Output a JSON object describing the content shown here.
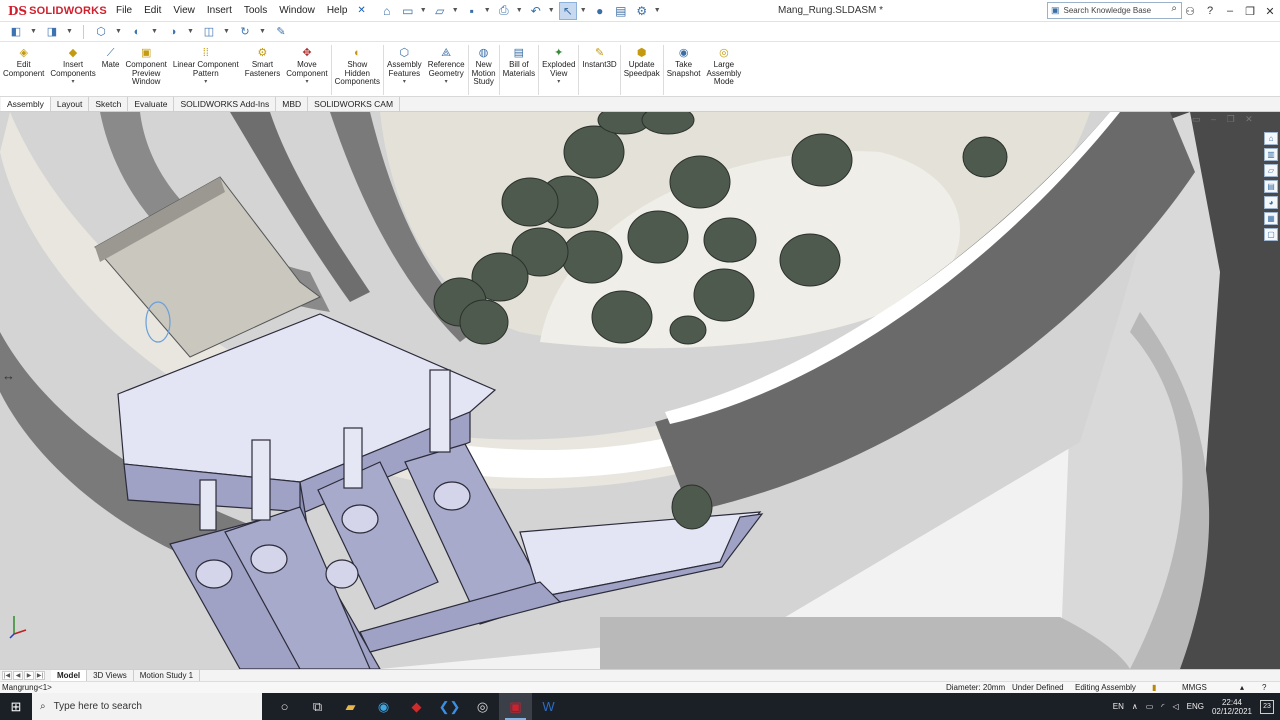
{
  "app": {
    "logo_mark": "DS",
    "logo_text": "SOLIDWORKS",
    "document_title": "Mang_Rung.SLDASM *"
  },
  "menu": [
    "File",
    "Edit",
    "View",
    "Insert",
    "Tools",
    "Window",
    "Help"
  ],
  "search": {
    "placeholder": "Search Knowledge Base"
  },
  "window_controls": {
    "help": "?",
    "minimize": "–",
    "restore": "❐",
    "close": "✕"
  },
  "ribbon": [
    {
      "label": "Edit\nComponent",
      "icon": "edit-component-icon",
      "glyph": "◈",
      "color": "ric-g"
    },
    {
      "label": "Insert\nComponents",
      "icon": "insert-components-icon",
      "glyph": "◆",
      "color": "ric-g",
      "dropdown": true
    },
    {
      "label": "Mate",
      "icon": "mate-icon",
      "glyph": "⟋",
      "color": "ric-b"
    },
    {
      "label": "Component\nPreview\nWindow",
      "icon": "preview-window-icon",
      "glyph": "▣",
      "color": "ric-g"
    },
    {
      "label": "Linear Component\nPattern",
      "icon": "linear-pattern-icon",
      "glyph": "⁞⁞",
      "color": "ric-g",
      "dropdown": true
    },
    {
      "label": "Smart\nFasteners",
      "icon": "smart-fasteners-icon",
      "glyph": "⚙",
      "color": "ric-g"
    },
    {
      "label": "Move\nComponent",
      "icon": "move-component-icon",
      "glyph": "✥",
      "color": "ric-r",
      "dropdown": true
    },
    {
      "label": "Show\nHidden\nComponents",
      "icon": "show-hidden-icon",
      "glyph": "◐",
      "color": "ric-g"
    },
    {
      "label": "Assembly\nFeatures",
      "icon": "assembly-features-icon",
      "glyph": "⬡",
      "color": "ric-b",
      "dropdown": true
    },
    {
      "label": "Reference\nGeometry",
      "icon": "reference-geometry-icon",
      "glyph": "⟁",
      "color": "ric-b",
      "dropdown": true
    },
    {
      "label": "New\nMotion\nStudy",
      "icon": "motion-study-icon",
      "glyph": "◍",
      "color": "ric-b"
    },
    {
      "label": "Bill of\nMaterials",
      "icon": "bom-icon",
      "glyph": "▤",
      "color": "ric-b"
    },
    {
      "label": "Exploded\nView",
      "icon": "exploded-view-icon",
      "glyph": "✦",
      "color": "ric-gn",
      "dropdown": true
    },
    {
      "label": "Instant3D",
      "icon": "instant3d-icon",
      "glyph": "✎",
      "color": "ric-g"
    },
    {
      "label": "Update\nSpeedpak",
      "icon": "speedpak-icon",
      "glyph": "⬢",
      "color": "ric-g"
    },
    {
      "label": "Take\nSnapshot",
      "icon": "snapshot-icon",
      "glyph": "◉",
      "color": "ric-b"
    },
    {
      "label": "Large\nAssembly\nMode",
      "icon": "large-assembly-icon",
      "glyph": "◎",
      "color": "ric-g"
    }
  ],
  "command_tabs": [
    "Assembly",
    "Layout",
    "Sketch",
    "Evaluate",
    "SOLIDWORKS Add-Ins",
    "MBD",
    "SOLIDWORKS CAM"
  ],
  "model_tabs": [
    "Model",
    "3D Views",
    "Motion Study 1"
  ],
  "status": {
    "context": "Mangrung<1>",
    "measure": "Diameter: 20mm",
    "definition": "Under Defined",
    "mode": "Editing Assembly",
    "units": "MMGS"
  },
  "taskbar": {
    "search_placeholder": "Type here to search",
    "lang1": "EN",
    "lang2": "ENG",
    "time": "22:44",
    "date": "02/12/2021",
    "notifications": "23"
  },
  "colors": {
    "accent": "#d0202e",
    "selection": "#c7d9ee",
    "model_grey": "#d6d6d6",
    "bracket": "#9fa2c4",
    "pegs": "#4f5a4f"
  }
}
